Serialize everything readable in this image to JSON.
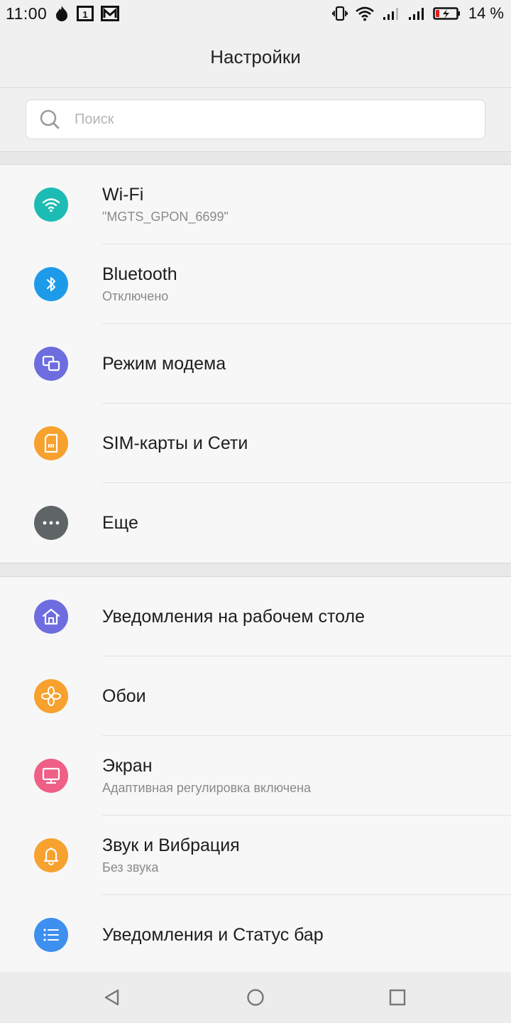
{
  "status_bar": {
    "time": "11:00",
    "battery_text": "14 %",
    "icons": [
      "fire-notification-icon",
      "sim-1-icon",
      "mail-icon",
      "vibrate-icon",
      "wifi-signal-icon",
      "cell-signal-1-icon",
      "cell-signal-2-icon",
      "battery-charging-icon"
    ]
  },
  "header": {
    "title": "Настройки"
  },
  "search": {
    "placeholder": "Поиск",
    "value": ""
  },
  "groups": [
    {
      "items": [
        {
          "title": "Wi-Fi",
          "subtitle": "\"MGTS_GPON_6699\"",
          "icon": "wifi-icon",
          "color": "#1cbcb4"
        },
        {
          "title": "Bluetooth",
          "subtitle": "Отключено",
          "icon": "bluetooth-icon",
          "color": "#1e9be8"
        },
        {
          "title": "Режим модема",
          "subtitle": "",
          "icon": "hotspot-icon",
          "color": "#6d6de0"
        },
        {
          "title": "SIM-карты и Сети",
          "subtitle": "",
          "icon": "sim-card-icon",
          "color": "#f7a12e"
        },
        {
          "title": "Еще",
          "subtitle": "",
          "icon": "more-icon",
          "color": "#5f6566"
        }
      ]
    },
    {
      "items": [
        {
          "title": "Уведомления на рабочем столе",
          "subtitle": "",
          "icon": "home-icon",
          "color": "#6d6de0"
        },
        {
          "title": "Обои",
          "subtitle": "",
          "icon": "flower-icon",
          "color": "#f7a12e"
        },
        {
          "title": "Экран",
          "subtitle": "Адаптивная регулировка включена",
          "icon": "display-icon",
          "color": "#ef5f86"
        },
        {
          "title": "Звук и Вибрация",
          "subtitle": "Без звука",
          "icon": "bell-icon",
          "color": "#f7a12e"
        },
        {
          "title": "Уведомления и Статус бар",
          "subtitle": "",
          "icon": "list-icon",
          "color": "#3d8ff0"
        }
      ]
    }
  ],
  "nav_bar": {
    "icons": [
      "back-icon",
      "home-button-icon",
      "recents-icon"
    ]
  }
}
